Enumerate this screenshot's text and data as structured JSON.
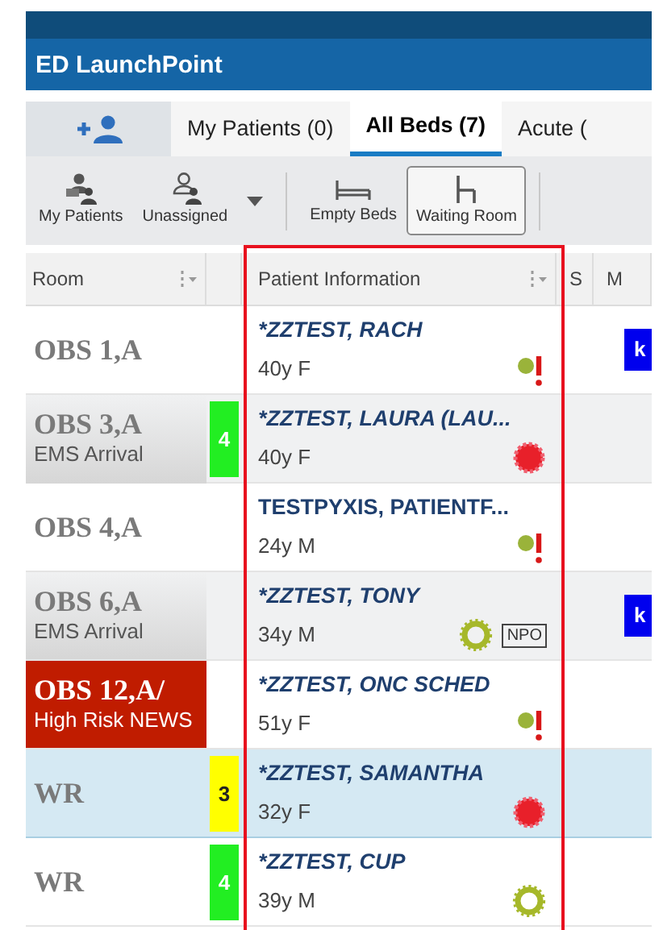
{
  "window": {
    "title": "ED LaunchPoint"
  },
  "tabs": [
    {
      "kind": "add-person",
      "selected": false
    },
    {
      "kind": "text",
      "label": "My Patients (0)",
      "selected": false
    },
    {
      "kind": "text",
      "label": "All Beds (7)",
      "selected": true
    },
    {
      "kind": "text",
      "label": "Acute (",
      "selected": false
    }
  ],
  "toolbar": [
    {
      "kind": "my-patients",
      "label": "My Patients",
      "selected": false
    },
    {
      "kind": "unassigned",
      "label": "Unassigned",
      "selected": false
    },
    {
      "kind": "caret"
    },
    {
      "kind": "divider"
    },
    {
      "kind": "empty-beds",
      "label": "Empty Beds",
      "selected": false
    },
    {
      "kind": "waiting-room",
      "label": "Waiting Room",
      "selected": true
    },
    {
      "kind": "divider"
    }
  ],
  "table": {
    "columns": [
      "Room",
      "",
      "Patient Information",
      "S",
      "M"
    ],
    "rows": [
      {
        "room": "OBS 1,A",
        "selected": false,
        "alert": false,
        "name": "*ZZTEST, RACH",
        "italic": true,
        "demo": "40y F",
        "icons": [
          {
            "kind": "flag-alert"
          }
        ],
        "m_badge": "k"
      },
      {
        "room": "OBS 3,A",
        "room_note": "EMS Arrival",
        "selected": false,
        "alert": false,
        "acuity": {
          "text": "4",
          "color": "#22ee22"
        },
        "name": "*ZZTEST, LAURA (LAU...",
        "italic": true,
        "demo": "40y F",
        "icons": [
          {
            "kind": "red-burst"
          }
        ]
      },
      {
        "room": "OBS 4,A",
        "selected": false,
        "alert": false,
        "name": "TESTPYXIS, PATIENTF...",
        "italic": false,
        "demo": "24y M",
        "icons": [
          {
            "kind": "flag-alert"
          }
        ]
      },
      {
        "room": "OBS 6,A",
        "room_note": "EMS Arrival",
        "selected": false,
        "alert": false,
        "name": "*ZZTEST, TONY",
        "italic": true,
        "demo": "34y M",
        "icons": [
          {
            "kind": "green-ring"
          }
        ],
        "tag": "NPO",
        "m_badge": "k"
      },
      {
        "room": "OBS 12,A/",
        "room_note": "High Risk NEWS",
        "selected": false,
        "alert": true,
        "name": "*ZZTEST, ONC SCHED",
        "italic": true,
        "demo": "51y F",
        "icons": [
          {
            "kind": "flag-alert"
          }
        ]
      },
      {
        "room": "WR",
        "selected": true,
        "alert": false,
        "acuity": {
          "text": "3",
          "color": "#ffff00"
        },
        "name": "*ZZTEST, SAMANTHA",
        "italic": true,
        "demo": "32y F",
        "icons": [
          {
            "kind": "red-burst"
          }
        ]
      },
      {
        "room": "WR",
        "selected": false,
        "alert": false,
        "acuity": {
          "text": "4",
          "color": "#22ee22"
        },
        "name": "*ZZTEST, CUP",
        "italic": true,
        "demo": "39y M",
        "icons": [
          {
            "kind": "green-ring"
          }
        ]
      }
    ]
  }
}
